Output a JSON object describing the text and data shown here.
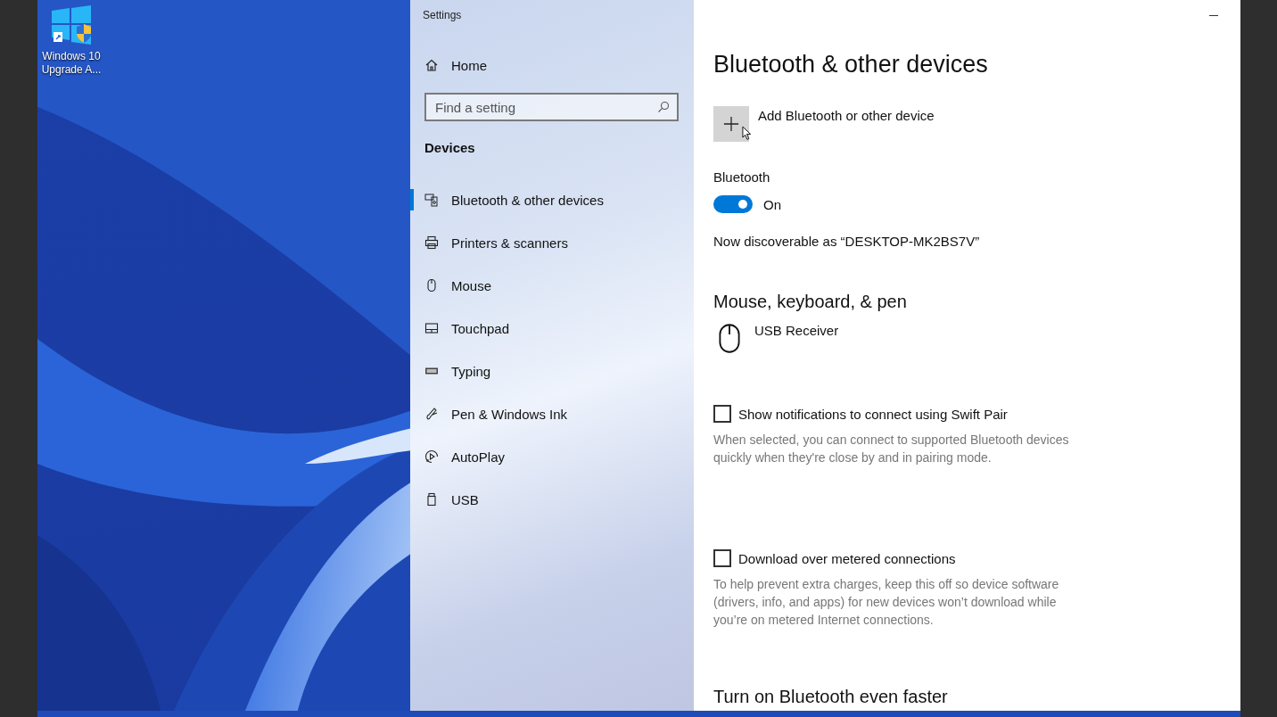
{
  "desktop_icons": [
    {
      "label": "Windows 10 Upgrade A..."
    }
  ],
  "window": {
    "title": "Settings"
  },
  "sidebar": {
    "home": "Home",
    "search": {
      "placeholder": "Find a setting"
    },
    "section": "Devices",
    "items": [
      {
        "label": "Bluetooth & other devices",
        "selected": true
      },
      {
        "label": "Printers & scanners",
        "selected": false
      },
      {
        "label": "Mouse",
        "selected": false
      },
      {
        "label": "Touchpad",
        "selected": false
      },
      {
        "label": "Typing",
        "selected": false
      },
      {
        "label": "Pen & Windows Ink",
        "selected": false
      },
      {
        "label": "AutoPlay",
        "selected": false
      },
      {
        "label": "USB",
        "selected": false
      }
    ]
  },
  "main": {
    "title": "Bluetooth & other devices",
    "add_device": "Add Bluetooth or other device",
    "bluetooth": {
      "label": "Bluetooth",
      "on": true,
      "state": "On"
    },
    "discoverable": "Now discoverable as “DESKTOP-MK2BS7V”",
    "devices_heading": "Mouse, keyboard, & pen",
    "devices": [
      {
        "name": "USB Receiver"
      }
    ],
    "options": [
      {
        "label": "Show notifications to connect using Swift Pair",
        "checked": false,
        "description": "When selected, you can connect to supported Bluetooth devices quickly when they're close by and in pairing mode."
      },
      {
        "label": "Download over metered connections",
        "checked": false,
        "description": "To help prevent extra charges, keep this off so device software (drivers, info, and apps) for new devices won’t download while you’re on metered Internet connections."
      }
    ],
    "next_heading": "Turn on Bluetooth even faster"
  }
}
